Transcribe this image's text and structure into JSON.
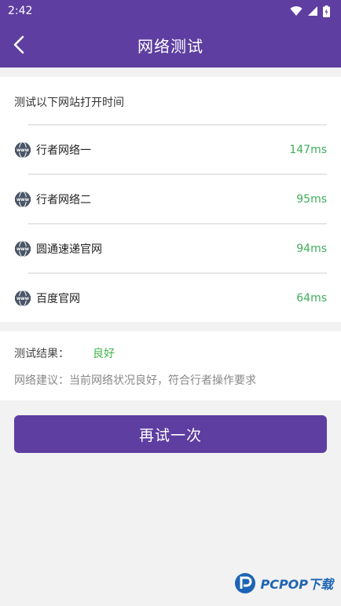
{
  "status_bar": {
    "time": "2:42"
  },
  "header": {
    "title": "网络测试"
  },
  "test_card": {
    "heading": "测试以下网站打开时间",
    "sites": [
      {
        "name": "行者网络一",
        "latency": "147ms"
      },
      {
        "name": "行者网络二",
        "latency": "95ms"
      },
      {
        "name": "圆通速递官网",
        "latency": "94ms"
      },
      {
        "name": "百度官网",
        "latency": "64ms"
      }
    ]
  },
  "result": {
    "label": "测试结果：",
    "value": "良好",
    "advice": "网络建议：当前网络状况良好，符合行者操作要求"
  },
  "actions": {
    "retry_label": "再试一次"
  },
  "watermark": {
    "text": "PCPOP下载"
  },
  "colors": {
    "brand": "#5e3ea1",
    "latency_green": "#3fae5b",
    "result_green": "#3fb44a"
  }
}
